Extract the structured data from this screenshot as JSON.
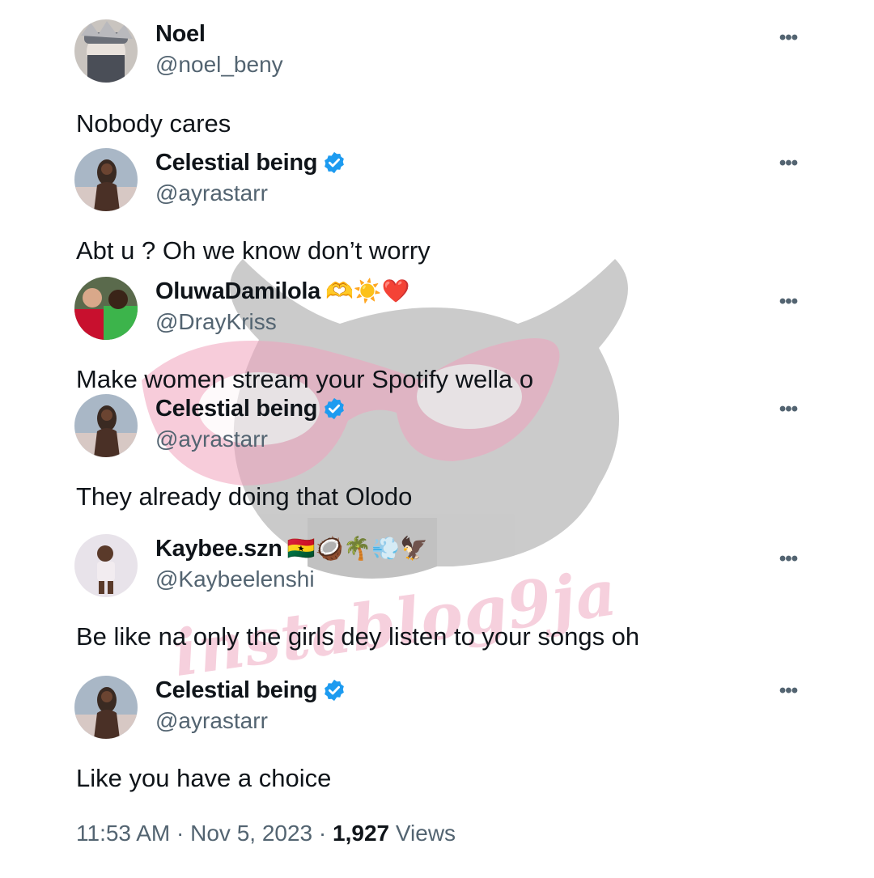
{
  "tweets": [
    {
      "display_name": "Noel",
      "handle": "@noel_beny",
      "verified": false,
      "badges": "",
      "text": "Nobody cares",
      "avatar": "anime-mask-avatar"
    },
    {
      "display_name": "Celestial being",
      "handle": "@ayrastarr",
      "verified": true,
      "badges": "",
      "text": "Abt u ? Oh we know don’t worry",
      "avatar": "woman-portrait-avatar"
    },
    {
      "display_name": "OluwaDamilola",
      "handle": "@DrayKriss",
      "verified": false,
      "badges": "🫶☀️❤️",
      "text": "Make women stream your Spotify wella o",
      "avatar": "football-players-avatar"
    },
    {
      "display_name": "Celestial being",
      "handle": "@ayrastarr",
      "verified": true,
      "badges": "",
      "text": "They already doing that Olodo",
      "avatar": "woman-portrait-avatar"
    },
    {
      "display_name": "Kaybee.szn",
      "handle": "@Kaybeelenshi",
      "verified": false,
      "badges": "🇬🇭🥥🌴💨🦅",
      "text": "Be like na only the girls dey listen to your songs oh",
      "avatar": "child-photo-avatar"
    },
    {
      "display_name": "Celestial being",
      "handle": "@ayrastarr",
      "verified": true,
      "badges": "",
      "text": "Like you have a choice",
      "avatar": "woman-portrait-avatar"
    }
  ],
  "footer": {
    "time": "11:53 AM",
    "date": "Nov 5, 2023",
    "views_count": "1,927",
    "views_label": "Views"
  },
  "watermark": {
    "text": "instablog9ja"
  },
  "colors": {
    "verified": "#1d9bf0",
    "secondary_text": "#536471",
    "primary_text": "#0f1419",
    "watermark_pink": "#ec96b4",
    "watermark_gray": "#a0a0a0"
  }
}
